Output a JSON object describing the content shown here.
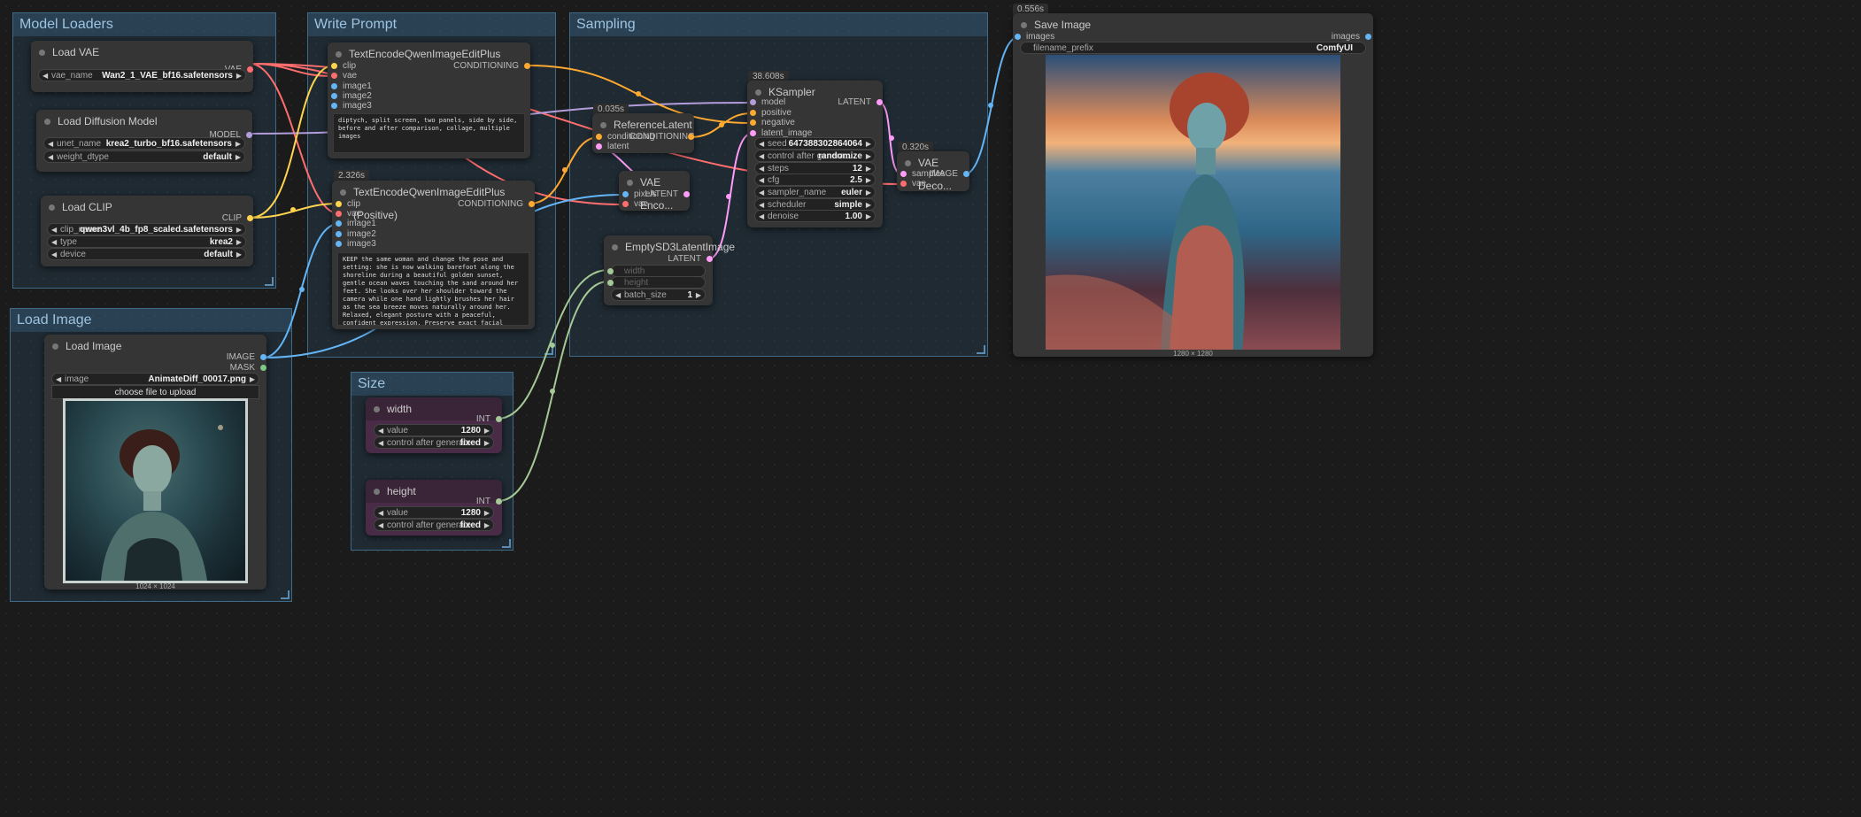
{
  "groups": {
    "model_loaders": "Model Loaders",
    "write_prompt": "Write Prompt",
    "sampling": "Sampling",
    "load_image": "Load Image",
    "size": "Size"
  },
  "nodes": {
    "load_vae": {
      "title": "Load VAE",
      "out": "VAE",
      "w_label": "vae_name",
      "w_value": "Wan2_1_VAE_bf16.safetensors"
    },
    "load_diffusion": {
      "title": "Load Diffusion Model",
      "out": "MODEL",
      "w1_label": "unet_name",
      "w1_value": "krea2_turbo_bf16.safetensors",
      "w2_label": "weight_dtype",
      "w2_value": "default"
    },
    "load_clip": {
      "title": "Load CLIP",
      "out": "CLIP",
      "w1_label": "clip_name",
      "w1_value": "qwen3vl_4b_fp8_scaled.safetensors",
      "w2_label": "type",
      "w2_value": "krea2",
      "w3_label": "device",
      "w3_value": "default"
    },
    "load_image": {
      "title": "Load Image",
      "out1": "IMAGE",
      "out2": "MASK",
      "w_label": "image",
      "w_value": "AnimateDiff_00017.png",
      "upload": "choose file to upload",
      "caption": "1024 × 1024"
    },
    "text_encode_neg": {
      "title": "TextEncodeQwenImageEditPlus",
      "in1": "clip",
      "in2": "vae",
      "in3": "image1",
      "in4": "image2",
      "in5": "image3",
      "out": "CONDITIONING",
      "text": "diptych, split screen, two panels, side by side, before and after comparison, collage, multiple images"
    },
    "text_encode_pos": {
      "badge": "2.326s",
      "title": "TextEncodeQwenImageEditPlus (Positive)",
      "in1": "clip",
      "in2": "vae",
      "in3": "image1",
      "in4": "image2",
      "in5": "image3",
      "out": "CONDITIONING",
      "text": "KEEP the same woman and change the pose and setting: she is now walking barefoot along the shoreline during a beautiful golden sunset, gentle ocean waves touching the sand around her feet. She looks over her shoulder toward the camera while one hand lightly brushes her hair as the sea breeze moves naturally around her. Relaxed, elegant posture with a peaceful, confident expression. Preserve exact facial identity, makeup, hairstyle, body proportions, clothing, accessories, and every visual detail from the reference image."
    },
    "reference_latent": {
      "badge": "0.035s",
      "title": "ReferenceLatent",
      "in1": "conditioning",
      "in2": "latent",
      "out": "CONDITIONING"
    },
    "vae_encode": {
      "title": "VAE Enco...",
      "in1": "pixels",
      "in2": "vae",
      "out": "LATENT"
    },
    "empty_latent": {
      "title": "EmptySD3LatentImage",
      "out": "LATENT",
      "w1_label": "width",
      "w2_label": "height",
      "w3_label": "batch_size",
      "w3_value": "1"
    },
    "ksampler": {
      "badge": "38.608s",
      "title": "KSampler",
      "in1": "model",
      "in2": "positive",
      "in3": "negative",
      "in4": "latent_image",
      "out": "LATENT",
      "w": [
        {
          "label": "seed",
          "value": "647388302864064"
        },
        {
          "label": "control after genera...",
          "value": "randomize"
        },
        {
          "label": "steps",
          "value": "12"
        },
        {
          "label": "cfg",
          "value": "2.5"
        },
        {
          "label": "sampler_name",
          "value": "euler"
        },
        {
          "label": "scheduler",
          "value": "simple"
        },
        {
          "label": "denoise",
          "value": "1.00"
        }
      ]
    },
    "vae_decode": {
      "badge": "0.320s",
      "title": "VAE Deco...",
      "in1": "samples",
      "in2": "vae",
      "out": "IMAGE"
    },
    "save_image": {
      "badge": "0.556s",
      "title": "Save Image",
      "in1": "images",
      "out": "images",
      "w_label": "filename_prefix",
      "w_value": "ComfyUI",
      "caption": "1280 × 1280"
    },
    "width": {
      "title": "width",
      "out": "INT",
      "w1_label": "value",
      "w1_value": "1280",
      "w2_label": "control after generate",
      "w2_value": "fixed"
    },
    "height": {
      "title": "height",
      "out": "INT",
      "w1_label": "value",
      "w1_value": "1280",
      "w2_label": "control after generate",
      "w2_value": "fixed"
    }
  },
  "colors": {
    "vae": "#ff6e6e",
    "model": "#b39ddb",
    "clip": "#ffd54f",
    "conditioning": "#ffa931",
    "latent": "#ff9cf9",
    "image": "#64b5f6",
    "int": "#a5c996",
    "mask": "#81c784"
  }
}
